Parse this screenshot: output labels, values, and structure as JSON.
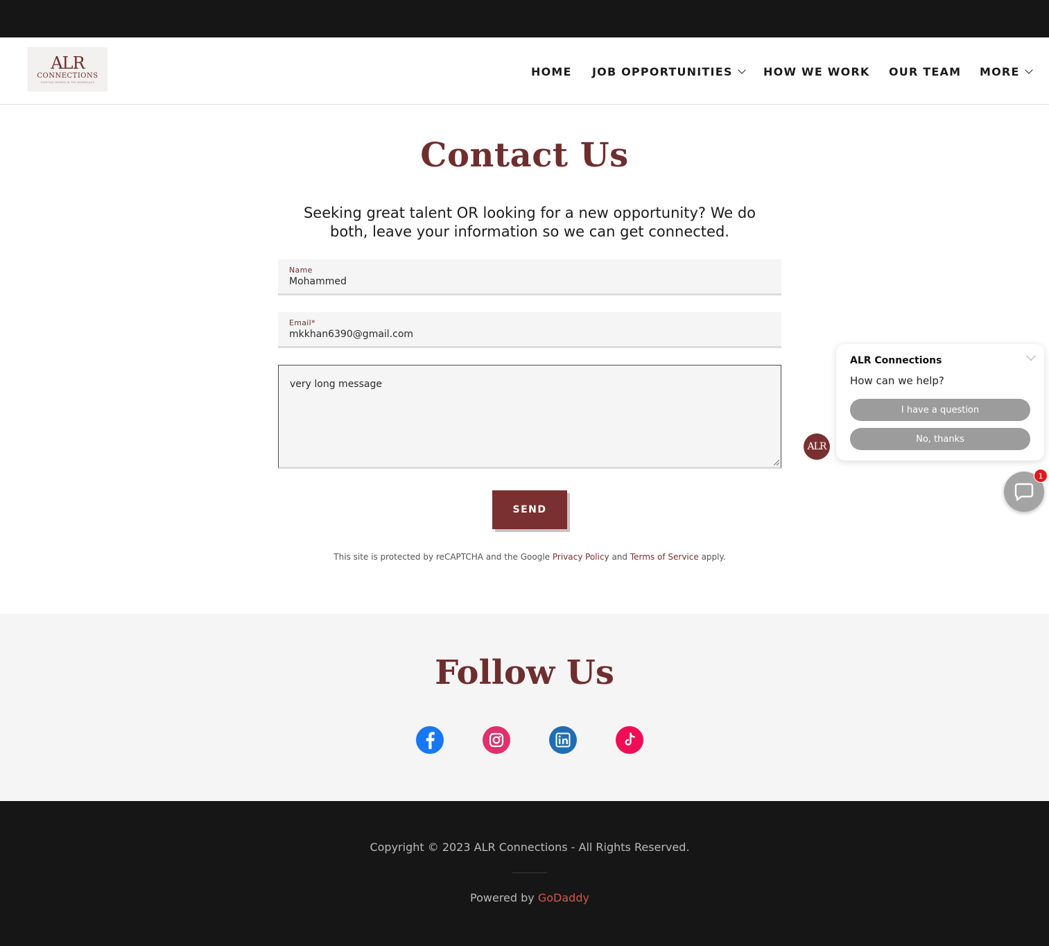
{
  "logo": {
    "line1": "ALR",
    "line2": "CONNECTIONS",
    "line3": "STAFFING WOMEN IN THE WORKPLACE"
  },
  "nav": {
    "items": [
      {
        "label": "HOME",
        "has_dropdown": false
      },
      {
        "label": "JOB OPPORTUNITIES",
        "has_dropdown": true
      },
      {
        "label": "HOW WE WORK",
        "has_dropdown": false
      },
      {
        "label": "OUR TEAM",
        "has_dropdown": false
      },
      {
        "label": "MORE",
        "has_dropdown": true
      }
    ]
  },
  "contact": {
    "title": "Contact Us",
    "intro_line1": "Seeking great talent OR looking for a new opportunity? We do",
    "intro_line2": "both, leave your information so we can get connected.",
    "name_label": "Name",
    "name_value": "Mohammed",
    "email_label": "Email*",
    "email_value": "mkkhan6390@gmail.com",
    "message_value": "very long message",
    "send_label": "SEND",
    "recaptcha_prefix": "This site is protected by reCAPTCHA and the Google ",
    "privacy_link": "Privacy Policy",
    "recaptcha_and": " and ",
    "terms_link": "Terms of Service",
    "recaptcha_suffix": " apply."
  },
  "follow": {
    "title": "Follow Us",
    "icons": [
      "facebook-icon",
      "instagram-icon",
      "linkedin-icon",
      "tiktok-icon"
    ]
  },
  "footer": {
    "copyright": "Copyright © 2023 ALR Connections - All Rights Reserved.",
    "powered_prefix": "Powered by ",
    "powered_link": "GoDaddy"
  },
  "chat": {
    "avatar_text": "ALR",
    "title": "ALR Connections",
    "question": "How can we help?",
    "option1": "I have a question",
    "option2": "No, thanks",
    "badge_count": "1"
  },
  "colors": {
    "brand": "#7a3030",
    "topbar": "#161616",
    "footer_bg": "#161616",
    "follow_bg": "#f5f5f5",
    "godaddy_link": "#d1584e"
  }
}
